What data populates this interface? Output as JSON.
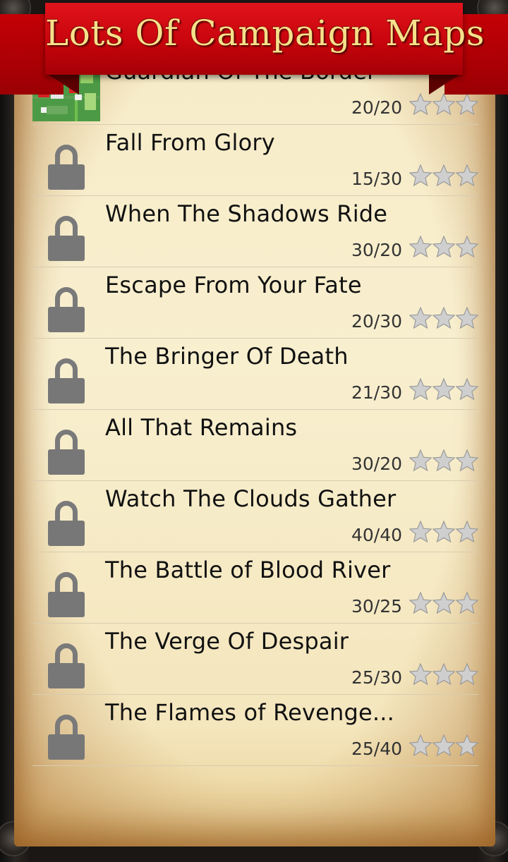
{
  "header": {
    "title": "Lots Of Campaign Maps"
  },
  "colors": {
    "banner": "#c8040c",
    "banner_text": "#f6e08a",
    "parchment": "#f7ecc8",
    "lock": "#777777",
    "star": "#cfcfcf"
  },
  "campaigns": [
    {
      "title": "Guardian Of The Border",
      "score": "20/20",
      "locked": false,
      "stars": 0,
      "icon": "map-thumbnail"
    },
    {
      "title": "Fall From Glory",
      "score": "15/30",
      "locked": true,
      "stars": 0,
      "icon": "lock-icon"
    },
    {
      "title": "When The Shadows Ride",
      "score": "30/20",
      "locked": true,
      "stars": 0,
      "icon": "lock-icon"
    },
    {
      "title": "Escape From Your Fate",
      "score": "20/30",
      "locked": true,
      "stars": 0,
      "icon": "lock-icon"
    },
    {
      "title": "The Bringer Of Death",
      "score": "21/30",
      "locked": true,
      "stars": 0,
      "icon": "lock-icon"
    },
    {
      "title": "All That Remains",
      "score": "30/20",
      "locked": true,
      "stars": 0,
      "icon": "lock-icon"
    },
    {
      "title": "Watch The Clouds Gather",
      "score": "40/40",
      "locked": true,
      "stars": 0,
      "icon": "lock-icon"
    },
    {
      "title": "The Battle of Blood River",
      "score": "30/25",
      "locked": true,
      "stars": 0,
      "icon": "lock-icon"
    },
    {
      "title": "The Verge Of Despair",
      "score": "25/30",
      "locked": true,
      "stars": 0,
      "icon": "lock-icon"
    },
    {
      "title": "The Flames of Revenge...",
      "score": "25/40",
      "locked": true,
      "stars": 0,
      "icon": "lock-icon"
    }
  ]
}
